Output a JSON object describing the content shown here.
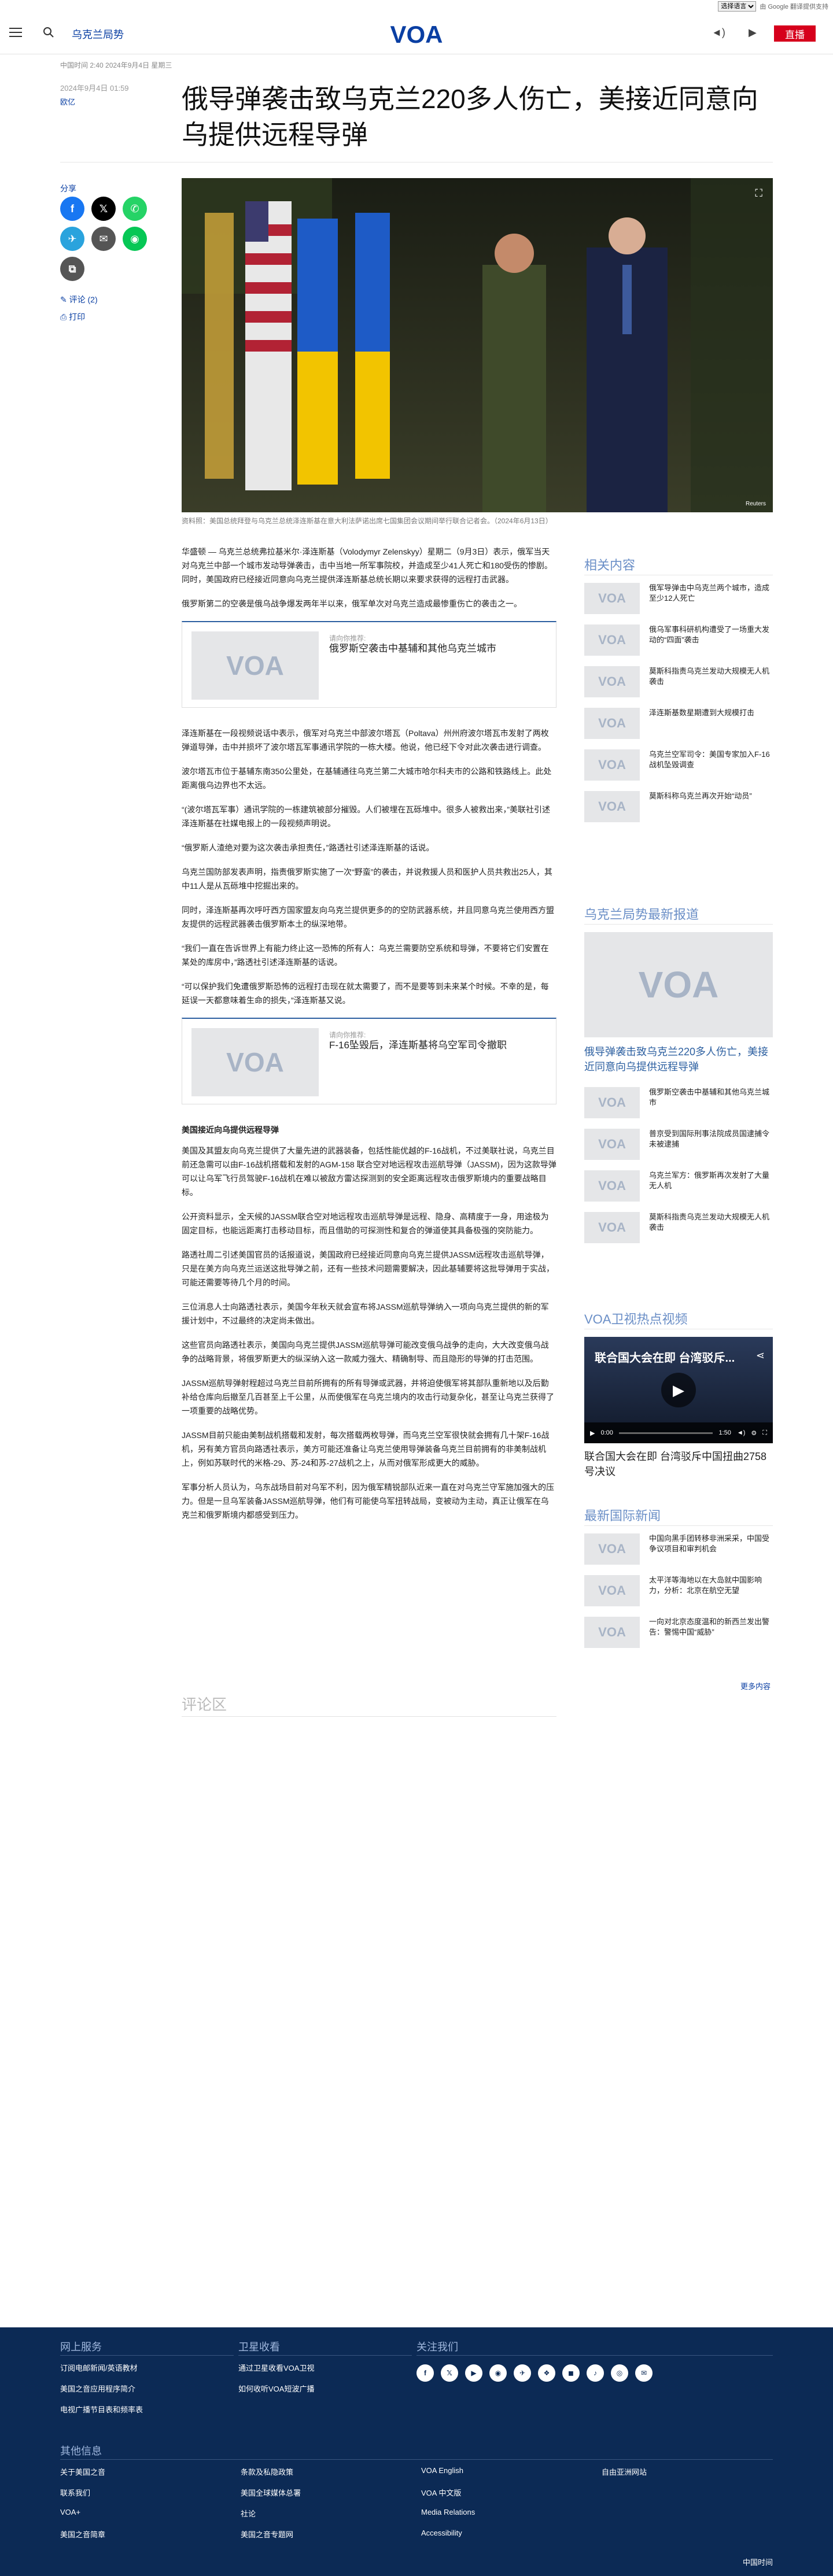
{
  "translate": {
    "select_value": "选择语言",
    "powered": "由 Google 翻译提供支持"
  },
  "header": {
    "section_link": "乌克兰局势",
    "audio_label": "◄)",
    "video_label": "▶︎",
    "live_label": "直播",
    "logo_text": "VOA"
  },
  "article": {
    "dateline": "中国时间 2:40 2024年9月4日 星期三",
    "pubdate": "2024年9月4日 01:59",
    "category": "欧亿",
    "title": "俄导弹袭击致乌克兰220多人伤亡，美接近同意向乌提供远程导弹",
    "share_label": "分享",
    "comments_link": "评论 (2)",
    "print_link": "打印",
    "caption": "资料照：美国总统拜登与乌克兰总统泽连斯基在意大利法萨诺出席七国集团会议期间举行联合记者会。（2024年6月13日）",
    "watermark": "Reuters",
    "paragraphs_a": [
      "华盛顿 — 乌克兰总统弗拉基米尔·泽连斯基（Volodymyr Zelenskyy）星期二（9月3日）表示，俄军当天对乌克兰中部一个城市发动导弹袭击，击中当地一所军事院校，并造成至少41人死亡和180受伤的惨剧。同时，美国政府已经接近同意向乌克兰提供泽连斯基总统长期以来要求获得的远程打击武器。",
      "俄罗斯第二的空袭是俄乌战争爆发两年半以来，俄军单次对乌克兰造成最惨重伤亡的袭击之一。"
    ],
    "related_1": {
      "label": "请向你推荐:",
      "title": "俄罗斯空袭击中基辅和其他乌克兰城市"
    },
    "paragraphs_b": [
      "泽连斯基在一段视频说话中表示，俄军对乌克兰中部波尔塔瓦（Poltava）州州府波尔塔瓦市发射了两枚弹道导弹，击中并损坏了波尔塔瓦军事通讯学院的一栋大楼。他说，他已经下令对此次袭击进行调查。",
      "波尔塔瓦市位于基辅东南350公里处，在基辅通往乌克兰第二大城市哈尔科夫市的公路和铁路线上。此处距离俄乌边界也不太远。",
      "“(波尔塔瓦军事）通讯学院的一栋建筑被部分摧毁。人们被埋在瓦砾堆中。很多人被救出来，”美联社引述泽连斯基在社媒电报上的一段视频声明说。",
      "“俄罗斯人渣绝对要为这次袭击承担责任，”路透社引述泽连斯基的话说。",
      "乌克兰国防部发表声明，指责俄罗斯实施了一次“野蛮”的袭击，并说救援人员和医护人员共救出25人，其中11人是从瓦砾堆中挖掘出来的。",
      "同时，泽连斯基再次呼吁西方国家盟友向乌克兰提供更多的的空防武器系统，并且同意乌克兰使用西方盟友提供的远程武器袭击俄罗斯本土的纵深地带。",
      "“我们一直在告诉世界上有能力终止这一恐怖的所有人：乌克兰需要防空系统和导弹，不要将它们安置在某处的库房中，”路透社引述泽连斯基的话说。",
      "“可以保护我们免遭俄罗斯恐怖的远程打击现在就太需要了，而不是要等到未来某个时候。不幸的是，每延误一天都意味着生命的损失，”泽连斯基又说。"
    ],
    "related_2": {
      "label": "请向你推荐:",
      "title": "F-16坠毁后，泽连斯基将乌空军司令撤职"
    },
    "subhead": "美国接近向乌提供远程导弹",
    "paragraphs_c": [
      "美国及其盟友向乌克兰提供了大量先进的武器装备，包括性能优越的F-16战机，不过美联社说，乌克兰目前还急需可以由F-16战机搭载和发射的AGM-158 联合空对地远程攻击巡航导弹（JASSM)，因为这款导弹可以让乌军飞行员驾驶F-16战机在难以被敌方雷达探测到的安全距离远程攻击俄罗斯境内的重要战略目标。",
      "公开资料显示，全天候的JASSM联合空对地远程攻击巡航导弹是远程、隐身、高精度于一身，用途极为固定目标，也能远距离打击移动目标，而且借助的可探测性和复合的弹道使其具备极强的突防能力。",
      "路透社周二引述美国官员的话报道说，美国政府已经接近同意向乌克兰提供JASSM远程攻击巡航导弹，只是在美方向乌克兰运送这批导弹之前，还有一些技术问题需要解决，因此基辅要将这批导弹用于实战，可能还需要等待几个月的时间。",
      "三位消息人士向路透社表示，美国今年秋天就会宣布将JASSM巡航导弹纳入一项向乌克兰提供的新的军援计划中，不过最终的决定尚未做出。",
      "这些官员向路透社表示，美国向乌克兰提供JASSM巡航导弹可能改变俄乌战争的走向，大大改变俄乌战争的战略背景，将俄罗斯更大的纵深纳入这一款威力强大、精确制导、而且隐形的导弹的打击范围。",
      "JASSM巡航导弹射程超过乌克兰目前所拥有的所有导弹或武器，并将迫使俄军将其部队重新地以及后勤补给仓库向后撤至几百甚至上千公里，从而使俄军在乌克兰境内的攻击行动复杂化，甚至让乌克兰获得了一项重要的战略优势。",
      "JASSM目前只能由美制战机搭载和发射，每次搭载两枚导弹，而乌克兰空军很快就会拥有几十架F-16战机，另有美方官员向路透社表示，美方可能还准备让乌克兰使用导弹装备乌克兰目前拥有的非美制战机上，例如苏联时代的米格-29、苏-24和苏-27战机之上，从而对俄军形成更大的威胁。",
      "军事分析人员认为，乌东战场目前对乌军不利，因为俄军精锐部队近来一直在对乌克兰守军施加强大的压力。但是一旦乌军装备JASSM巡航导弹，他们有可能使乌军扭转战局，变被动为主动，真正让俄军在乌克兰和俄罗斯境内都感受到压力。"
    ],
    "comments_heading": "评论区"
  },
  "sidebar": {
    "related_heading": "相关内容",
    "related_items": [
      "俄军导弹击中乌克兰两个城市，造成至少12人死亡",
      "俄乌军事科研机构遭受了一场重大发动的“四面”袭击",
      "莫斯科指责乌克兰发动大规模无人机袭击",
      "泽连斯基数星期遭到大规模打击",
      "乌克兰空军司令：美国专家加入F-16战机坠毁调查",
      "莫斯科称乌克兰再次开始“动员”"
    ],
    "latest_heading": "乌克兰局势最新报道",
    "latest_featured": "俄导弹袭击致乌克兰220多人伤亡，美接近同意向乌提供远程导弹",
    "latest_items": [
      "俄罗斯空袭击中基辅和其他乌克兰城市",
      "普京受到国际刑事法院成员国逮捕令未被逮捕",
      "乌克兰军方：俄罗斯再次发射了大量无人机",
      "莫斯科指责乌克兰发动大规模无人机袭击"
    ],
    "video_heading": "VOA卫视热点视频",
    "video_overlay": "联合国大会在即 台湾驳斥...",
    "video_time": "0:00",
    "video_duration": "1:50",
    "video_title": "联合国大会在即 台湾驳斥中国扭曲2758号决议",
    "intl_heading": "最新国际新闻",
    "intl_items": [
      "中国向黑手团转移非洲采采，中国受争议项目和审判机会",
      "太平洋等海地以在大岛就中国影响力，分析：北京在航空无望",
      "一向对北京态度温和的新西兰发出警告：警惕中国“威胁”"
    ],
    "more_link": "更多内容"
  },
  "footer": {
    "col1_heading": "网上服务",
    "col1_links": [
      "订阅电邮新闻/英语教材",
      "美国之音应用程序简介",
      "电视广播节目表和频率表"
    ],
    "col2_heading": "卫星收看",
    "col2_links": [
      "通过卫星收看VOA卫视",
      "如何收听VOA短波广播"
    ],
    "col3_heading": "关注我们",
    "social_icons": [
      "f",
      "𝕏",
      "▶",
      "◉",
      "✈",
      "❖",
      "◼",
      "♪",
      "◎",
      "✉"
    ],
    "other_heading": "其他信息",
    "other_cols": [
      [
        "关于美国之音",
        "联系我们",
        "VOA+",
        "美国之音简章"
      ],
      [
        "条款及私隐政策",
        "美国全球媒体总署",
        "社论",
        "美国之音专题网"
      ],
      [
        "VOA English",
        "VOA 中文版",
        "Media Relations",
        "Accessibility"
      ],
      [
        "自由亚洲网站"
      ]
    ],
    "timezone": "中国时间"
  },
  "colors": {
    "accent": "#0a3fa3",
    "live": "#d6001c",
    "footer": "#0c2a55"
  }
}
